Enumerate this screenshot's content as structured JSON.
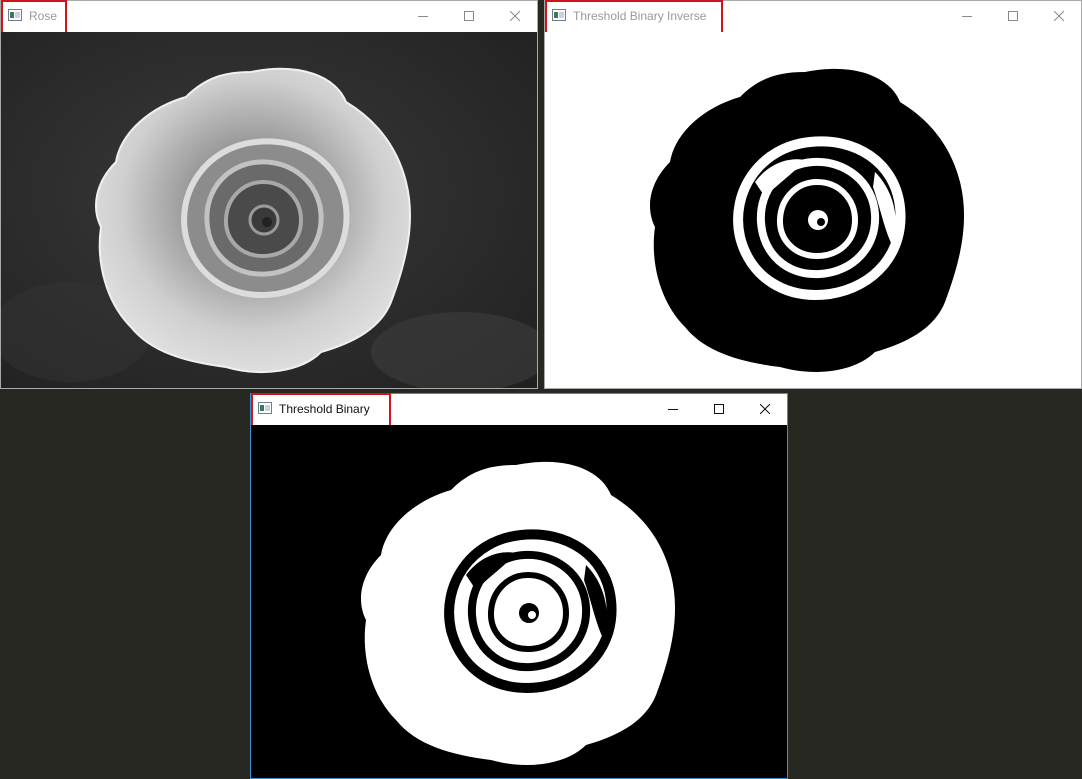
{
  "desktop": {
    "background": "#272822"
  },
  "windows": {
    "rose": {
      "title": "Rose",
      "image": "grayscale-rose-photo"
    },
    "inverse": {
      "title": "Threshold Binary Inverse",
      "image": "threshold-binary-inverse-rose"
    },
    "binary": {
      "title": "Threshold Binary",
      "image": "threshold-binary-rose"
    }
  },
  "controls": {
    "minimize": "minimize-icon",
    "maximize": "maximize-icon",
    "close": "close-icon"
  },
  "colors": {
    "highlight": "#d3131b",
    "active_border": "#3b8fd6"
  }
}
